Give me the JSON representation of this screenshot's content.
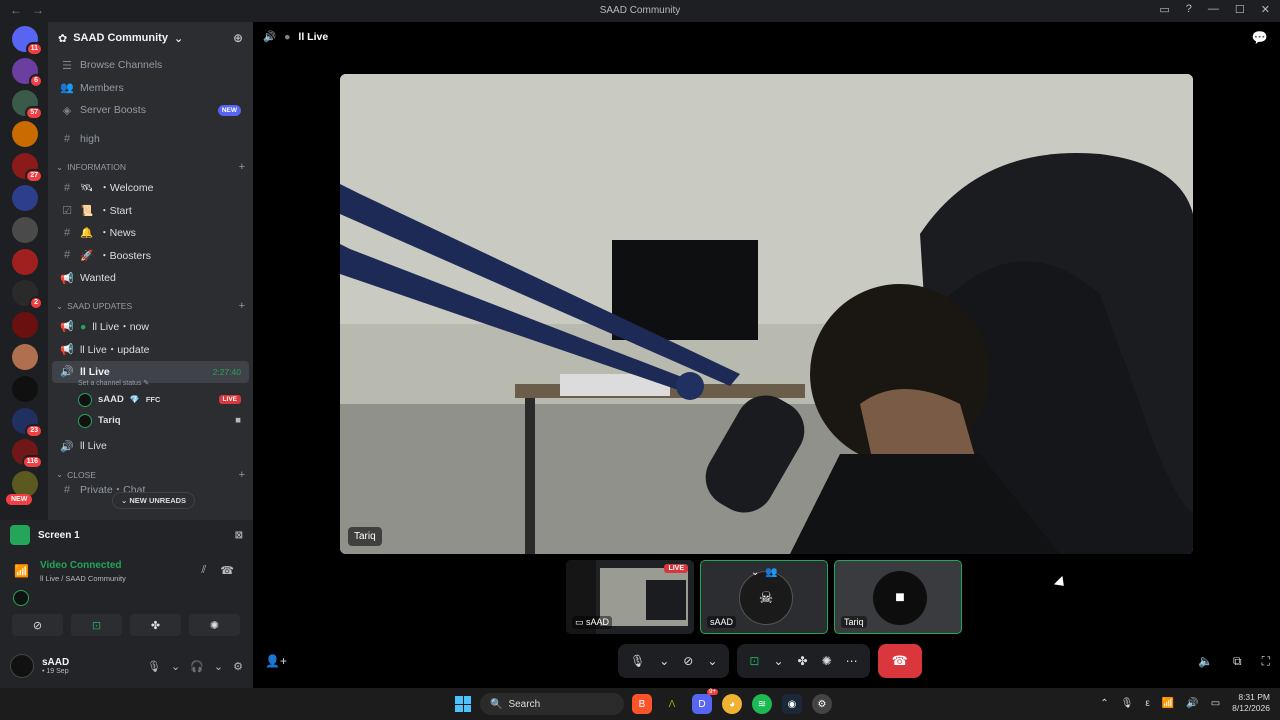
{
  "window": {
    "title": "SAAD Community"
  },
  "guilds": [
    {
      "badge": "11",
      "color": "#5865f2"
    },
    {
      "badge": "6",
      "color": "#6b3fa0"
    },
    {
      "badge": "57",
      "color": "#3a5a4a"
    },
    {
      "badge": "",
      "color": "#c96b00"
    },
    {
      "badge": "27",
      "color": "#8b1a1a"
    },
    {
      "badge": "",
      "color": "#2c3e8c"
    },
    {
      "badge": "",
      "color": "#4a4a4a"
    },
    {
      "badge": "",
      "color": "#a02020"
    },
    {
      "badge": "2",
      "color": "#2a2a2a"
    },
    {
      "badge": "",
      "color": "#6a1010"
    },
    {
      "badge": "",
      "color": "#b07050"
    },
    {
      "badge": "",
      "color": "#101010"
    },
    {
      "badge": "23",
      "color": "#203060"
    },
    {
      "badge": "116",
      "color": "#701818"
    },
    {
      "badge": "",
      "color": "#5a5a20"
    }
  ],
  "guild_new_label": "NEW",
  "server": {
    "name": "SAAD Community"
  },
  "top_items": [
    {
      "label": "Browse Channels",
      "icon": "browse-icon"
    },
    {
      "label": "Members",
      "icon": "members-icon"
    },
    {
      "label": "Server Boosts",
      "icon": "boost-icon",
      "badge": "NEW"
    }
  ],
  "high_channel": "high",
  "categories": {
    "information": "INFORMATION",
    "updates": "SAAD UPDATES",
    "close": "CLOSE"
  },
  "info_channels": [
    "・Welcome",
    "・Start",
    "・News",
    "・Boosters",
    "Wanted"
  ],
  "update_channels": [
    "ll Live・now",
    "ll Live・update"
  ],
  "voice": {
    "name": "ll Live",
    "timer": "2:27:40",
    "status": "Set a channel status",
    "users": [
      {
        "name": "sAAD",
        "tag": "FFC",
        "live": "LIVE"
      },
      {
        "name": "Tariq"
      }
    ]
  },
  "voice2": "ll Live",
  "new_unreads": "NEW UNREADS",
  "partial_channel": "Private・Chat",
  "screen_share": {
    "label": "Screen 1"
  },
  "connection": {
    "status": "Video Connected",
    "location": "ll Live / SAAD Community"
  },
  "user": {
    "name": "sAAD",
    "status": "• 19 Sep"
  },
  "stage": {
    "title": "ll Live",
    "main_name": "Tariq",
    "tiles": [
      {
        "name": "sAAD",
        "live": "LIVE"
      },
      {
        "name": "sAAD"
      },
      {
        "name": "Tariq"
      }
    ]
  },
  "taskbar": {
    "search": "Search",
    "time": "8:31 PM",
    "date": "8/12/2026",
    "discord_badge": "9+"
  },
  "colors": {
    "accent": "#5865f2",
    "green": "#23a55a",
    "red": "#da373c"
  }
}
